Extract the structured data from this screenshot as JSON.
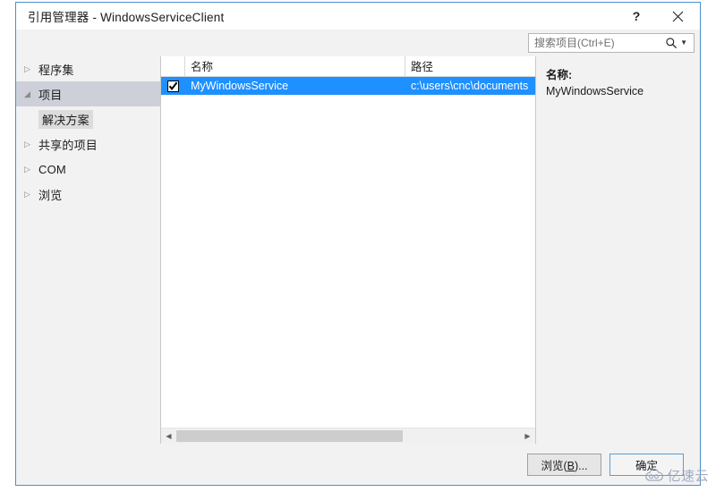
{
  "window": {
    "title": "引用管理器 - WindowsServiceClient",
    "help_label": "?",
    "close_label": "✕",
    "accent_color": "#4a90c9",
    "selection_color": "#1e90ff"
  },
  "search": {
    "placeholder": "搜索项目(Ctrl+E)",
    "value": "",
    "icon": "search-icon",
    "dropdown_icon": "chevron-down-icon"
  },
  "sidebar": {
    "items": [
      {
        "label": "程序集",
        "expanded": false,
        "selected": false,
        "sub": false
      },
      {
        "label": "项目",
        "expanded": true,
        "selected": true,
        "sub": false
      },
      {
        "label": "解决方案",
        "expanded": false,
        "selected": false,
        "sub": true
      },
      {
        "label": "共享的项目",
        "expanded": false,
        "selected": false,
        "sub": false
      },
      {
        "label": "COM",
        "expanded": false,
        "selected": false,
        "sub": false
      },
      {
        "label": "浏览",
        "expanded": false,
        "selected": false,
        "sub": false
      }
    ]
  },
  "list": {
    "columns": [
      "名称",
      "路径"
    ],
    "rows": [
      {
        "checked": true,
        "name": "MyWindowsService",
        "path": "c:\\users\\cnc\\documents",
        "selected": true
      }
    ],
    "hscroll": {
      "left_arrow": "◀",
      "right_arrow": "▶",
      "thumb_start_percent": 0,
      "thumb_width_percent": 66
    }
  },
  "detail": {
    "label": "名称:",
    "value": "MyWindowsService"
  },
  "footer": {
    "browse_label_prefix": "浏览(",
    "browse_label_key": "B",
    "browse_label_suffix": ")...",
    "ok_label": "确定"
  },
  "watermark": {
    "text": "亿速云"
  }
}
